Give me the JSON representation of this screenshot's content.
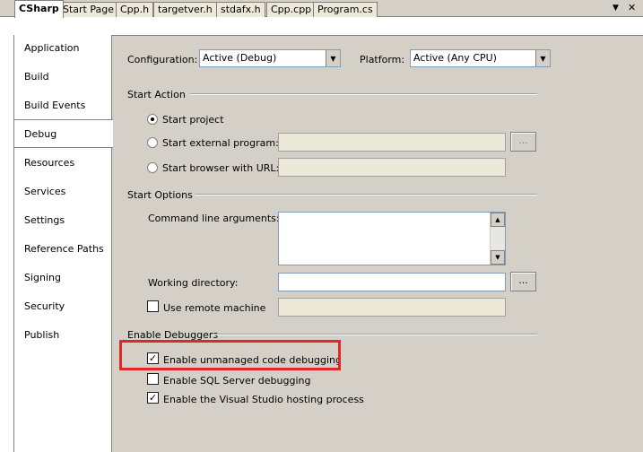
{
  "tabs": [
    {
      "label": "CSharp",
      "active": true
    },
    {
      "label": "Start Page"
    },
    {
      "label": "Cpp.h"
    },
    {
      "label": "targetver.h"
    },
    {
      "label": "stdafx.h"
    },
    {
      "label": "Cpp.cpp"
    },
    {
      "label": "Program.cs"
    }
  ],
  "tabstrip": {
    "dropdown_icon": "▼",
    "close_icon": "✕"
  },
  "nav": {
    "items": [
      "Application",
      "Build",
      "Build Events",
      "Debug",
      "Resources",
      "Services",
      "Settings",
      "Reference Paths",
      "Signing",
      "Security",
      "Publish"
    ],
    "selected": "Debug"
  },
  "config": {
    "configuration_label": "Configuration:",
    "configuration_value": "Active (Debug)",
    "platform_label": "Platform:",
    "platform_value": "Active (Any CPU)"
  },
  "start_action": {
    "title": "Start Action",
    "start_project": "Start project",
    "start_external": "Start external program:",
    "start_browser": "Start browser with URL:",
    "browse_label": "...",
    "selected": "Start project"
  },
  "start_options": {
    "title": "Start Options",
    "command_line_label": "Command line arguments:",
    "working_dir_label": "Working directory:",
    "browse_label": "...",
    "remote_label": "Use remote machine",
    "remote_checked": false
  },
  "debuggers": {
    "title": "Enable Debuggers",
    "unmanaged_label": "Enable unmanaged code debugging",
    "unmanaged_checked": true,
    "sql_label": "Enable SQL Server debugging",
    "sql_checked": false,
    "hosting_label": "Enable the Visual Studio hosting process",
    "hosting_checked": true,
    "check_mark": "✓"
  },
  "colors": {
    "highlight": "#e0282a",
    "panel": "#d4d0c8"
  }
}
